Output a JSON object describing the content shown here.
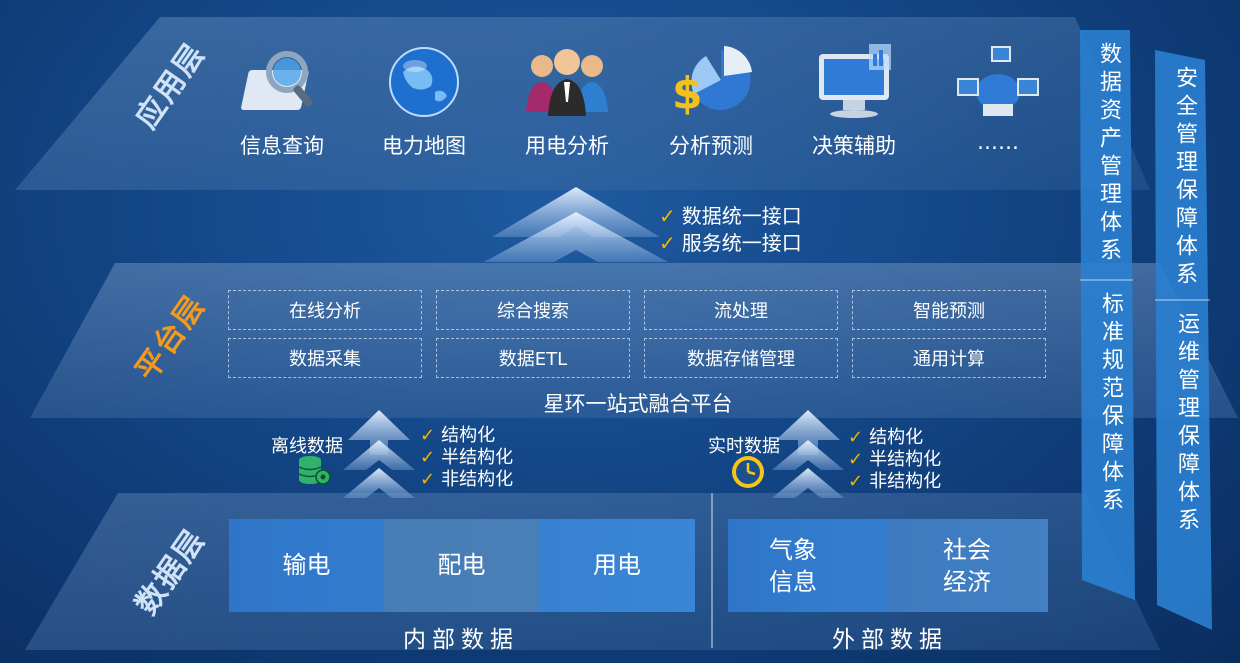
{
  "app_layer": {
    "label": "应用层",
    "items": [
      {
        "label": "信息查询",
        "icon": "magnifier-search-icon"
      },
      {
        "label": "电力地图",
        "icon": "globe-icon"
      },
      {
        "label": "用电分析",
        "icon": "users-group-icon"
      },
      {
        "label": "分析预测",
        "icon": "dollar-pie-chart-icon"
      },
      {
        "label": "决策辅助",
        "icon": "monitor-chart-icon"
      },
      {
        "label": "……",
        "icon": "network-computers-icon"
      }
    ]
  },
  "interfaces": [
    "数据统一接口",
    "服务统一接口"
  ],
  "platform_layer": {
    "label": "平台层",
    "capabilities": [
      "在线分析",
      "综合搜索",
      "流处理",
      "智能预测",
      "数据采集",
      "数据ETL",
      "数据存储管理",
      "通用计算"
    ],
    "platform_name": "星环一站式融合平台"
  },
  "ingest": {
    "offline": {
      "label": "离线数据",
      "icon": "database-gear-icon",
      "types": [
        "结构化",
        "半结构化",
        "非结构化"
      ]
    },
    "realtime": {
      "label": "实时数据",
      "icon": "clock-icon",
      "types": [
        "结构化",
        "半结构化",
        "非结构化"
      ]
    }
  },
  "data_layer": {
    "label": "数据层",
    "internal": {
      "tiles": [
        "输电",
        "配电",
        "用电"
      ],
      "caption": "内部数据"
    },
    "external": {
      "tiles": [
        "气象信息",
        "社会经济"
      ],
      "caption": "外部数据"
    }
  },
  "side_columns": {
    "left_top": "数据资产管理体系",
    "left_bottom": "标准规范保障体系",
    "right_top": "安全管理保障体系",
    "right_bottom": "运维管理保障体系"
  },
  "colors": {
    "check": "#f0b800",
    "platform_label": "#f39a1e",
    "layer_label": "#cfe2f7",
    "side_column": "#2a7fd0"
  }
}
